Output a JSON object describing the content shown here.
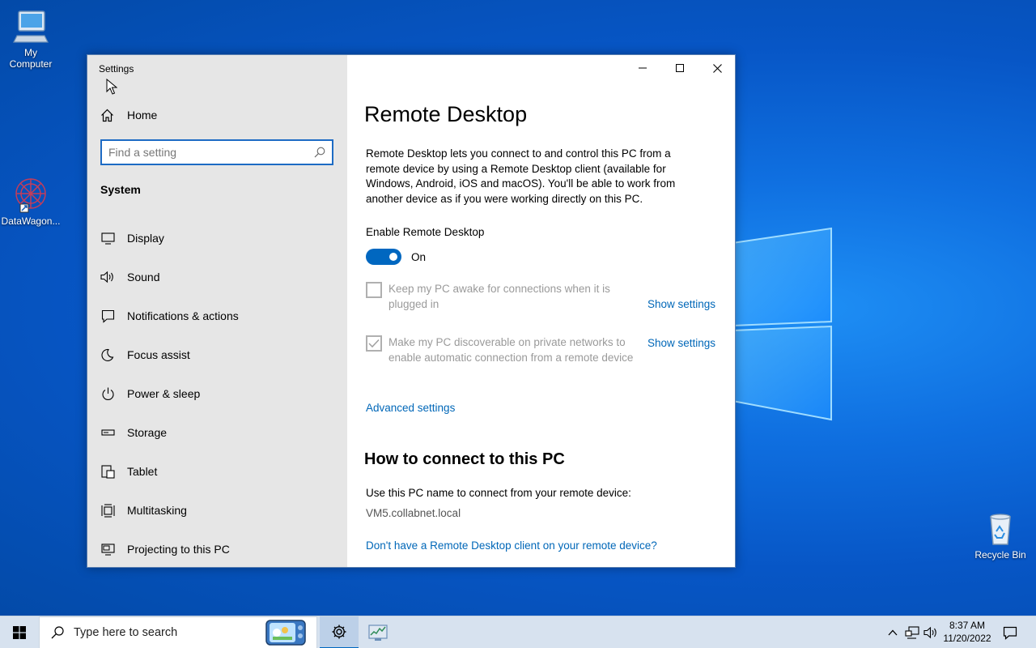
{
  "desktop": {
    "icons": [
      {
        "label": "My\nComputer",
        "icon": "computer-icon"
      },
      {
        "label": "DataWagon...",
        "icon": "datawagon-icon"
      },
      {
        "label": "Recycle Bin",
        "icon": "recycle-bin-icon"
      }
    ]
  },
  "window": {
    "title": "Settings",
    "controls": [
      "minimize",
      "maximize",
      "close"
    ]
  },
  "sidebar": {
    "home_label": "Home",
    "search_placeholder": "Find a setting",
    "section_title": "System",
    "items": [
      {
        "label": "Display",
        "icon": "display-icon"
      },
      {
        "label": "Sound",
        "icon": "speaker-icon"
      },
      {
        "label": "Notifications & actions",
        "icon": "notification-icon"
      },
      {
        "label": "Focus assist",
        "icon": "moon-icon"
      },
      {
        "label": "Power & sleep",
        "icon": "power-icon"
      },
      {
        "label": "Storage",
        "icon": "storage-icon"
      },
      {
        "label": "Tablet",
        "icon": "tablet-icon"
      },
      {
        "label": "Multitasking",
        "icon": "multitasking-icon"
      },
      {
        "label": "Projecting to this PC",
        "icon": "projecting-icon"
      }
    ]
  },
  "content": {
    "title": "Remote Desktop",
    "description": "Remote Desktop lets you connect to and control this PC from a remote device by using a Remote Desktop client (available for Windows, Android, iOS and macOS). You'll be able to work from another device as if you were working directly on this PC.",
    "enable_label": "Enable Remote Desktop",
    "toggle_state": "On",
    "toggle_on": true,
    "keep_awake": {
      "text": "Keep my PC awake for connections when it is plugged in",
      "checked": false,
      "link": "Show settings"
    },
    "discoverable": {
      "text": "Make my PC discoverable on private networks to enable automatic connection from a remote device",
      "checked": true,
      "link": "Show settings"
    },
    "advanced_link": "Advanced settings",
    "connect_title": "How to connect to this PC",
    "connect_text": "Use this PC name to connect from your remote device:",
    "pc_name": "VM5.collabnet.local",
    "client_link": "Don't have a Remote Desktop client on your remote device?"
  },
  "taskbar": {
    "search_placeholder": "Type here to search",
    "time": "8:37 AM",
    "date": "11/20/2022"
  },
  "colors": {
    "accent": "#0067c0",
    "link": "#0067b8",
    "sidebar_bg": "#e6e6e6",
    "taskbar_bg": "#d7e2ef"
  }
}
